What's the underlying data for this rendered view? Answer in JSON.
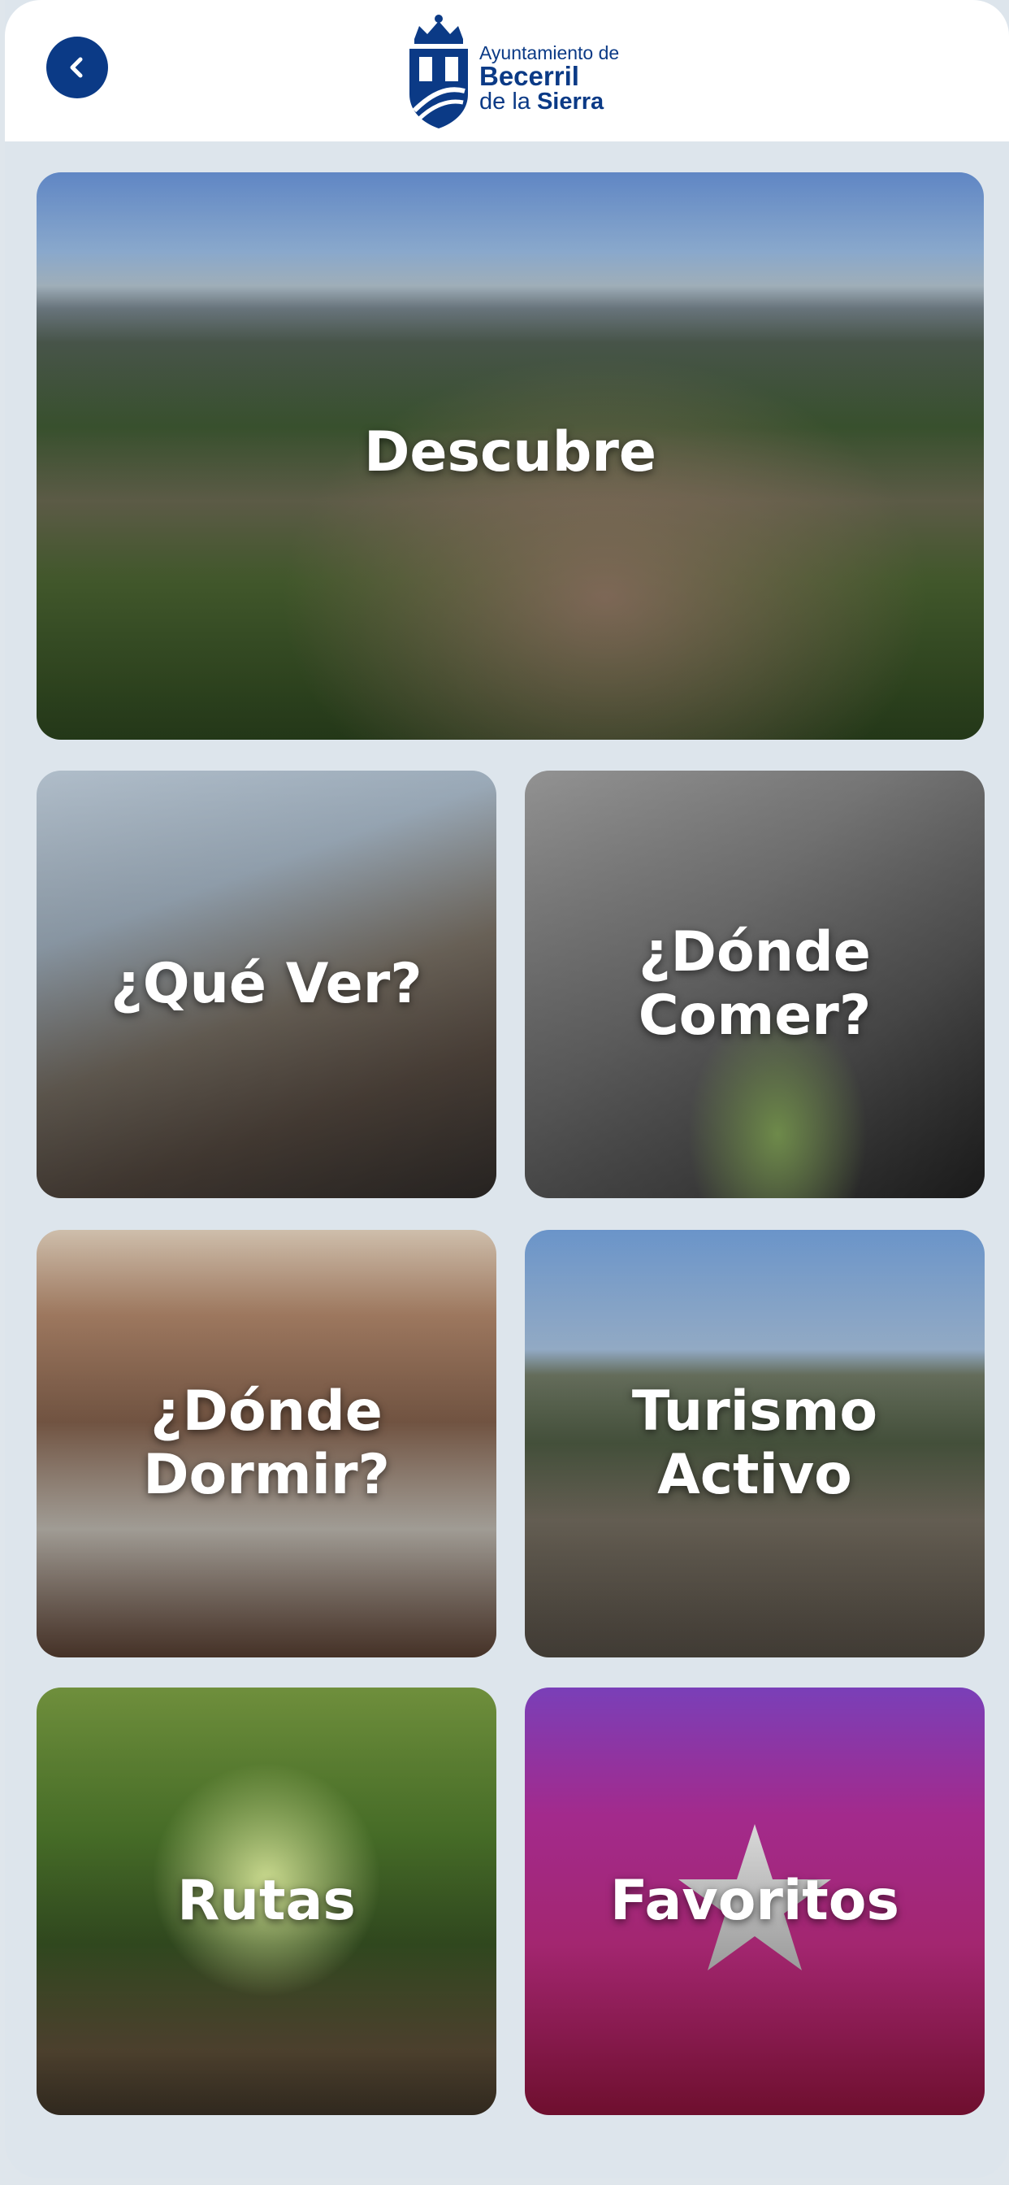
{
  "header": {
    "back_icon": "chevron-left-icon",
    "logo": {
      "line1": "Ayuntamiento de",
      "line2": "Becerril",
      "line3_prefix": "de la ",
      "line3_bold": "Sierra"
    }
  },
  "tiles": {
    "descubre": {
      "label": "Descubre"
    },
    "que_ver": {
      "line1": "¿Qué Ver?"
    },
    "donde_comer": {
      "line1": "¿Dónde",
      "line2": "Comer?"
    },
    "donde_dormir": {
      "line1": "¿Dónde",
      "line2": "Dormir?"
    },
    "turismo_activo": {
      "line1": "Turismo",
      "line2": "Activo"
    },
    "rutas": {
      "label": "Rutas"
    },
    "favoritos": {
      "label": "Favoritos",
      "icon": "star-icon"
    }
  },
  "colors": {
    "brand_blue": "#0b3a86",
    "background": "#dde5ec",
    "favoritos_gradient": [
      "#7a3fb8",
      "#a32670",
      "#6e0f2e"
    ]
  }
}
